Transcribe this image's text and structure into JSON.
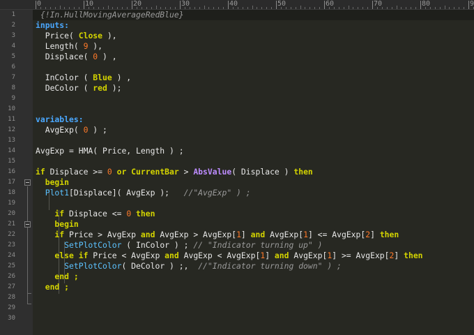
{
  "editor": {
    "ruler": {
      "labels": [
        "0",
        "10",
        "20",
        "30",
        "40",
        "50",
        "60",
        "70",
        "80",
        "9"
      ]
    },
    "line_numbers": [
      "1",
      "2",
      "3",
      "4",
      "5",
      "6",
      "7",
      "8",
      "9",
      "10",
      "11",
      "12",
      "13",
      "14",
      "15",
      "16",
      "17",
      "18",
      "19",
      "20",
      "21",
      "22",
      "23",
      "24",
      "25",
      "26",
      "27",
      "28",
      "29",
      "30"
    ],
    "lines": [
      [
        {
          "t": " {!In.HullMovingAverageRedBlue}",
          "c": "cm"
        }
      ],
      [
        {
          "t": "inputs:",
          "c": "kwb"
        }
      ],
      [
        {
          "t": "  Price( ",
          "c": "tx"
        },
        {
          "t": "Close",
          "c": "kw"
        },
        {
          "t": " ),",
          "c": "tx"
        }
      ],
      [
        {
          "t": "  Length( ",
          "c": "tx"
        },
        {
          "t": "9",
          "c": "num"
        },
        {
          "t": " ),",
          "c": "tx"
        }
      ],
      [
        {
          "t": "  Displace( ",
          "c": "tx"
        },
        {
          "t": "0",
          "c": "num"
        },
        {
          "t": " ) ,",
          "c": "tx"
        }
      ],
      [],
      [
        {
          "t": "  InColor ( ",
          "c": "tx"
        },
        {
          "t": "Blue",
          "c": "kw"
        },
        {
          "t": " ) ,",
          "c": "tx"
        }
      ],
      [
        {
          "t": "  DeColor ( ",
          "c": "tx"
        },
        {
          "t": "red",
          "c": "kw"
        },
        {
          "t": " );",
          "c": "tx"
        }
      ],
      [],
      [],
      [
        {
          "t": "variables:",
          "c": "kwb"
        }
      ],
      [
        {
          "t": "  AvgExp( ",
          "c": "tx"
        },
        {
          "t": "0",
          "c": "num"
        },
        {
          "t": " ) ;",
          "c": "tx"
        }
      ],
      [],
      [
        {
          "t": "AvgExp = HMA( Price, Length ) ;",
          "c": "tx"
        }
      ],
      [],
      [
        {
          "t": "if",
          "c": "kw"
        },
        {
          "t": " Displace >= ",
          "c": "tx"
        },
        {
          "t": "0",
          "c": "num"
        },
        {
          "t": " ",
          "c": "tx"
        },
        {
          "t": "or",
          "c": "kw"
        },
        {
          "t": " ",
          "c": "tx"
        },
        {
          "t": "CurrentBar",
          "c": "kw"
        },
        {
          "t": " > ",
          "c": "tx"
        },
        {
          "t": "AbsValue",
          "c": "fn"
        },
        {
          "t": "( Displace ) ",
          "c": "tx"
        },
        {
          "t": "then",
          "c": "kw"
        }
      ],
      [
        {
          "t": "  begin",
          "c": "kw"
        }
      ],
      [
        {
          "t": "  Plot1",
          "c": "fnb"
        },
        {
          "t": "[Displace]( AvgExp );   ",
          "c": "tx"
        },
        {
          "t": "//\"AvgExp\" ) ;",
          "c": "cm"
        }
      ],
      [],
      [
        {
          "t": "    if",
          "c": "kw"
        },
        {
          "t": " Displace <= ",
          "c": "tx"
        },
        {
          "t": "0",
          "c": "num"
        },
        {
          "t": " ",
          "c": "tx"
        },
        {
          "t": "then",
          "c": "kw"
        }
      ],
      [
        {
          "t": "    begin",
          "c": "kw"
        }
      ],
      [
        {
          "t": "    if",
          "c": "kw"
        },
        {
          "t": " Price > AvgExp ",
          "c": "tx"
        },
        {
          "t": "and",
          "c": "kw"
        },
        {
          "t": " AvgExp > AvgExp[",
          "c": "tx"
        },
        {
          "t": "1",
          "c": "num"
        },
        {
          "t": "] ",
          "c": "tx"
        },
        {
          "t": "and",
          "c": "kw"
        },
        {
          "t": " AvgExp[",
          "c": "tx"
        },
        {
          "t": "1",
          "c": "num"
        },
        {
          "t": "] <= AvgExp[",
          "c": "tx"
        },
        {
          "t": "2",
          "c": "num"
        },
        {
          "t": "] ",
          "c": "tx"
        },
        {
          "t": "then",
          "c": "kw"
        }
      ],
      [
        {
          "t": "      SetPlotColor",
          "c": "fnb"
        },
        {
          "t": " ( InColor ) ; ",
          "c": "tx"
        },
        {
          "t": "// \"Indicator turning up\" )",
          "c": "cm"
        }
      ],
      [
        {
          "t": "    else if",
          "c": "kw"
        },
        {
          "t": " Price < AvgExp ",
          "c": "tx"
        },
        {
          "t": "and",
          "c": "kw"
        },
        {
          "t": " AvgExp < AvgExp[",
          "c": "tx"
        },
        {
          "t": "1",
          "c": "num"
        },
        {
          "t": "] ",
          "c": "tx"
        },
        {
          "t": "and",
          "c": "kw"
        },
        {
          "t": " AvgExp[",
          "c": "tx"
        },
        {
          "t": "1",
          "c": "num"
        },
        {
          "t": "] >= AvgExp[",
          "c": "tx"
        },
        {
          "t": "2",
          "c": "num"
        },
        {
          "t": "] ",
          "c": "tx"
        },
        {
          "t": "then",
          "c": "kw"
        }
      ],
      [
        {
          "t": "      SetPlotColor",
          "c": "fnb"
        },
        {
          "t": "( DeColor ) ;,  ",
          "c": "tx"
        },
        {
          "t": "//\"Indicator turning down\" ) ;",
          "c": "cm"
        }
      ],
      [
        {
          "t": "    end ;",
          "c": "kw"
        }
      ],
      [
        {
          "t": "  end ;",
          "c": "kw"
        }
      ],
      [],
      [],
      []
    ]
  }
}
